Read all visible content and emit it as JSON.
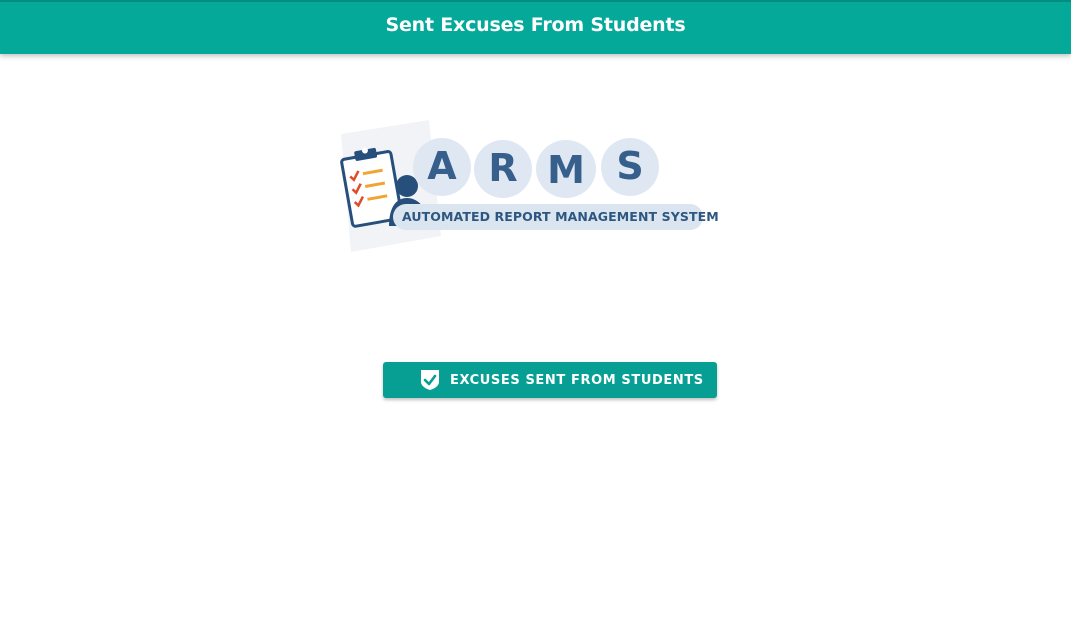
{
  "header": {
    "title": "Sent Excuses From Students",
    "color": "#05a99a"
  },
  "logo": {
    "letters": [
      "A",
      "R",
      "M",
      "S"
    ],
    "subtitle": "AUTOMATED REPORT MANAGEMENT SYSTEM",
    "icon": "clipboard-checklist-person-icon"
  },
  "main": {
    "button_label": "EXCUSES SENT FROM STUDENTS",
    "button_icon": "shield-check-icon",
    "button_color": "#079f93"
  }
}
